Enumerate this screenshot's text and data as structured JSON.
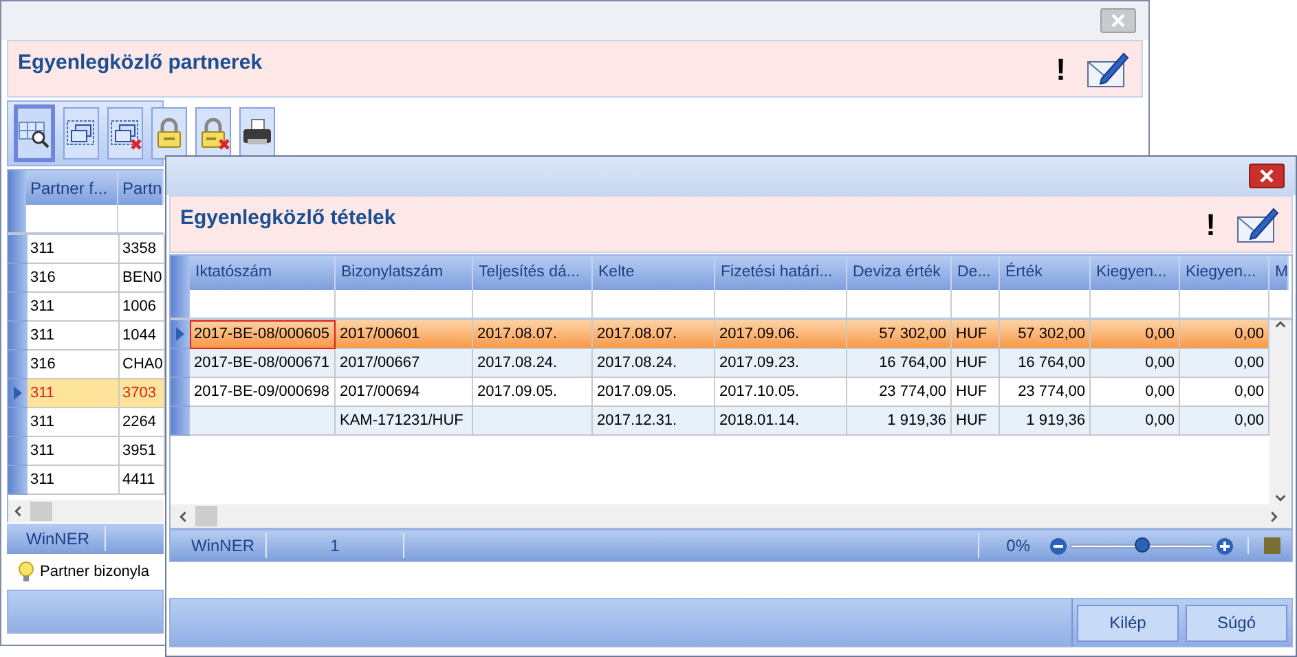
{
  "back_window": {
    "title": "Egyenlegközlő partnerek",
    "alert": "!",
    "toolbar": [
      {
        "kind": "grid-search",
        "selected": true
      },
      {
        "kind": "windows",
        "selected": false
      },
      {
        "kind": "windows-remove",
        "selected": false
      },
      {
        "kind": "lock",
        "selected": false
      },
      {
        "kind": "lock-remove",
        "selected": false
      },
      {
        "kind": "printer",
        "selected": false
      }
    ],
    "table": {
      "columns": [
        "Partner f...",
        "Partn"
      ],
      "rows": [
        {
          "cells": [
            "311",
            "3358"
          ],
          "selected": false
        },
        {
          "cells": [
            "316",
            "BEN0"
          ],
          "selected": false
        },
        {
          "cells": [
            "311",
            "1006"
          ],
          "selected": false
        },
        {
          "cells": [
            "311",
            "1044"
          ],
          "selected": false
        },
        {
          "cells": [
            "316",
            "CHA0"
          ],
          "selected": false
        },
        {
          "cells": [
            "311",
            "3703"
          ],
          "selected": true
        },
        {
          "cells": [
            "311",
            "2264"
          ],
          "selected": false
        },
        {
          "cells": [
            "311",
            "3951"
          ],
          "selected": false
        },
        {
          "cells": [
            "311",
            "4411"
          ],
          "selected": false
        }
      ]
    },
    "status_bar": {
      "app": "WinNER"
    },
    "hint": "Partner bizonyla"
  },
  "front_window": {
    "title": "Egyenlegközlő tételek",
    "alert": "!",
    "table": {
      "columns": [
        {
          "label": "Iktatószám",
          "kind": "text"
        },
        {
          "label": "Bizonylatszám",
          "kind": "text"
        },
        {
          "label": "Teljesítés dá...",
          "kind": "text"
        },
        {
          "label": "Kelte",
          "kind": "text"
        },
        {
          "label": "Fizetési határi...",
          "kind": "text"
        },
        {
          "label": "Deviza érték",
          "kind": "amount"
        },
        {
          "label": "De...",
          "kind": "text"
        },
        {
          "label": "Érték",
          "kind": "amount"
        },
        {
          "label": "Kiegyen...",
          "kind": "amount"
        },
        {
          "label": "Kiegyen...",
          "kind": "amount"
        },
        {
          "label": "M"
        }
      ],
      "rows": [
        {
          "cells": [
            "2017-BE-08/000605",
            "2017/00601",
            "2017.08.07.",
            "2017.08.07.",
            "2017.09.06.",
            "57 302,00",
            "HUF",
            "57 302,00",
            "0,00",
            "0,00"
          ],
          "selected": true
        },
        {
          "cells": [
            "2017-BE-08/000671",
            "2017/00667",
            "2017.08.24.",
            "2017.08.24.",
            "2017.09.23.",
            "16 764,00",
            "HUF",
            "16 764,00",
            "0,00",
            "0,00"
          ],
          "selected": false
        },
        {
          "cells": [
            "2017-BE-09/000698",
            "2017/00694",
            "2017.09.05.",
            "2017.09.05.",
            "2017.10.05.",
            "23 774,00",
            "HUF",
            "23 774,00",
            "0,00",
            "0,00"
          ],
          "selected": false
        },
        {
          "cells": [
            null,
            "KAM-171231/HUF",
            null,
            "2017.12.31.",
            "2018.01.14.",
            "1 919,36",
            "HUF",
            "1 919,36",
            "0,00",
            "0,00"
          ],
          "selected": false
        }
      ]
    },
    "status_bar": {
      "app": "WinNER",
      "count": "1",
      "zoom": "0%",
      "level": 0.5
    },
    "buttons": [
      "Kilép",
      "Súgó"
    ]
  }
}
